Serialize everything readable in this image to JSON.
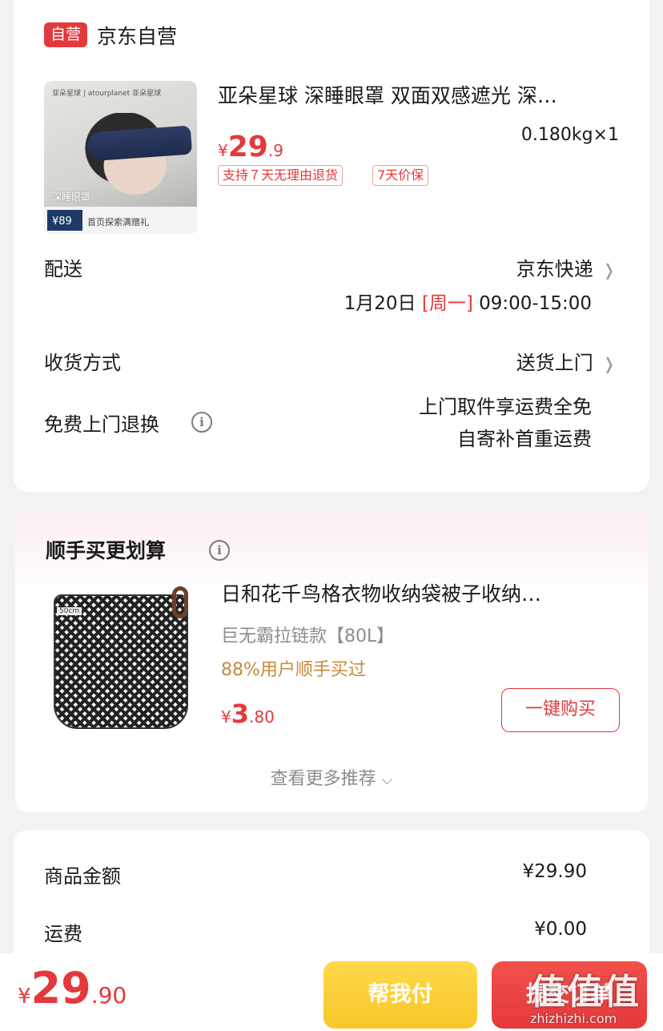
{
  "shop": {
    "badge": "自营",
    "name": "京东自营"
  },
  "product": {
    "title": "亚朵星球 深睡眼罩 双面双感遮光 深…",
    "price_yen": "¥",
    "price_int": "29",
    "price_dec": ".9",
    "qty": "0.180kg×1",
    "tags": [
      "支持７天无理由退货",
      "7天价保"
    ],
    "thumb": {
      "brand": "亚朵星球 | atourplanet 亚朵星球",
      "label": "深睡眼罩",
      "promo_price": "¥89",
      "promo_text": "首页探索满赠礼"
    }
  },
  "delivery": {
    "label": "配送",
    "value": "京东快递",
    "date": "1月20日",
    "weekday": "[周一]",
    "time": "09:00-15:00"
  },
  "receive": {
    "label": "收货方式",
    "value": "送货上门"
  },
  "free_return": {
    "label": "免费上门退换",
    "line1": "上门取件享运费全免",
    "line2": "自寄补首重运费"
  },
  "reco": {
    "title": "顺手买更划算",
    "item_title": "日和花千鸟格衣物收纳袋被子收纳…",
    "item_variant": "巨无霸拉链款【80L】",
    "item_social": "88%用户顺手买过",
    "item_price_yen": "¥",
    "item_price_int": "3",
    "item_price_dec": ".80",
    "thumb_tag": "50cm",
    "buy_label": "一键购买",
    "more_label": "查看更多推荐"
  },
  "amount": {
    "rows": [
      {
        "label": "商品金额",
        "value": "¥29.90"
      },
      {
        "label": "运费",
        "value": "¥0.00"
      }
    ]
  },
  "bottom": {
    "total_yen": "¥",
    "total_int": "29",
    "total_dec": ".90",
    "help_pay": "帮我付",
    "submit": "提交订单"
  },
  "watermark": {
    "big": "值值值",
    "small": "zhizhizhi.com"
  },
  "colors": {
    "accent": "#e4393c",
    "help_btn": "#f8c72a",
    "social_text": "#c8893b"
  },
  "icons": [
    "info-icon",
    "chevron-right-icon",
    "chevron-down-icon"
  ]
}
